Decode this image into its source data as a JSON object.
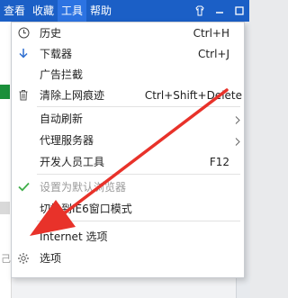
{
  "menubar": {
    "items": [
      {
        "label": "查看"
      },
      {
        "label": "收藏"
      },
      {
        "label": "工具"
      },
      {
        "label": "帮助"
      }
    ]
  },
  "tools_menu": {
    "items": [
      {
        "label": "历史",
        "shortcut": "Ctrl+H",
        "icon": "clock-icon"
      },
      {
        "label": "下载器",
        "shortcut": "Ctrl+J",
        "icon": "download-arrow-icon"
      },
      {
        "label": "广告拦截",
        "shortcut": "",
        "icon": ""
      },
      {
        "label": "清除上网痕迹",
        "shortcut": "Ctrl+Shift+Delete",
        "icon": "trash-icon"
      },
      {
        "label": "自动刷新",
        "shortcut": "",
        "icon": "",
        "submenu": true
      },
      {
        "label": "代理服务器",
        "shortcut": "",
        "icon": "",
        "submenu": true
      },
      {
        "label": "开发人员工具",
        "shortcut": "F12",
        "icon": ""
      },
      {
        "label": "设置为默认浏览器",
        "shortcut": "",
        "icon": "checkmark-icon",
        "disabled": true
      },
      {
        "label": "切换到IE6窗口模式",
        "shortcut": "",
        "icon": ""
      },
      {
        "label": "Internet 选项",
        "shortcut": "",
        "icon": ""
      },
      {
        "label": "选项",
        "shortcut": "",
        "icon": "gear-icon"
      }
    ]
  },
  "colors": {
    "titlebar": "#1b5fc6",
    "annotation_arrow": "#e8322a"
  }
}
